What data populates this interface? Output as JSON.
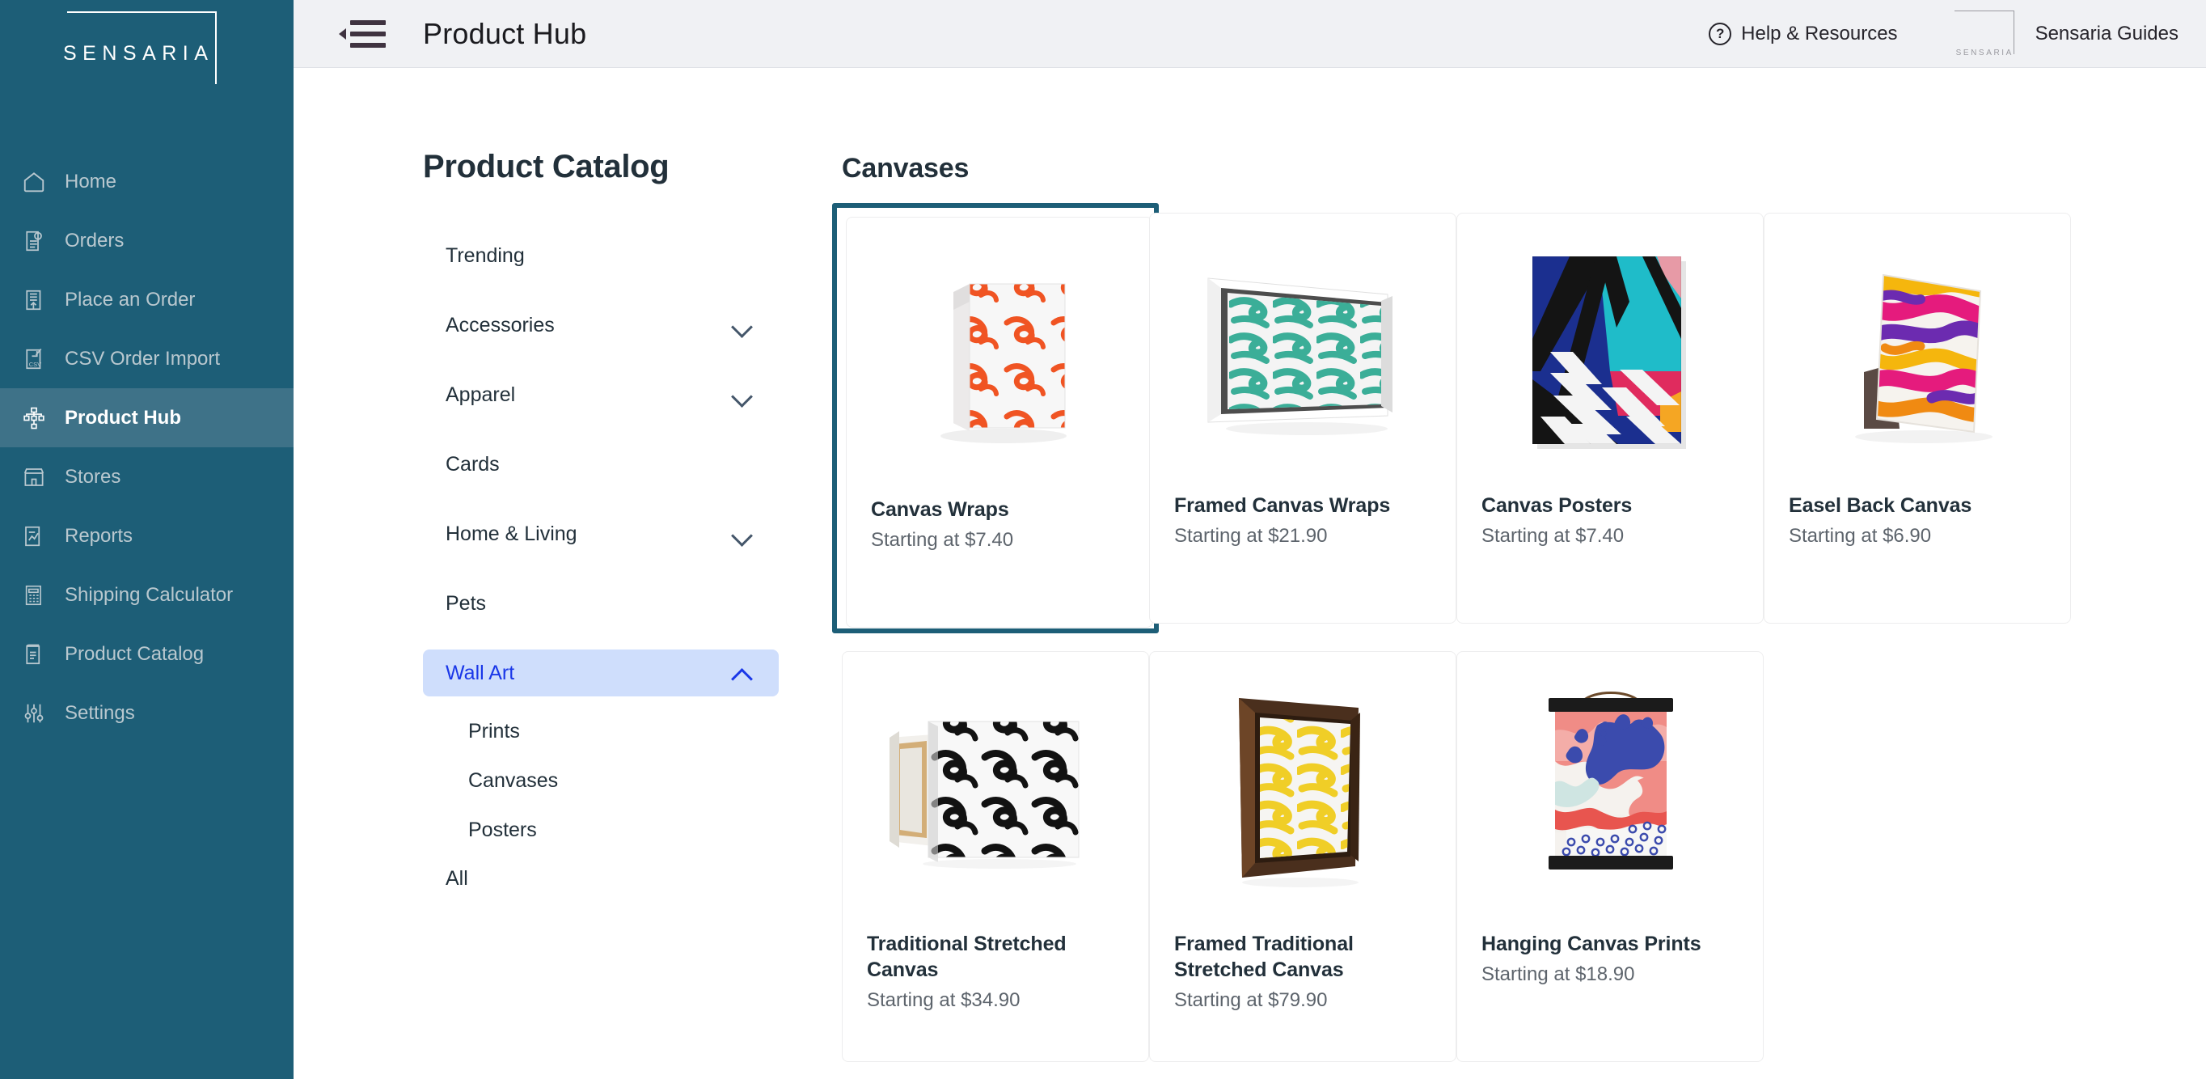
{
  "brand": {
    "name": "SENSARIA"
  },
  "sidebar": {
    "items": [
      {
        "label": "Home",
        "icon": "home-icon",
        "active": false
      },
      {
        "label": "Orders",
        "icon": "orders-document-icon",
        "active": false
      },
      {
        "label": "Place an Order",
        "icon": "place-order-icon",
        "active": false
      },
      {
        "label": "CSV Order Import",
        "icon": "csv-import-icon",
        "active": false
      },
      {
        "label": "Product Hub",
        "icon": "product-hub-icon",
        "active": true
      },
      {
        "label": "Stores",
        "icon": "storefront-icon",
        "active": false
      },
      {
        "label": "Reports",
        "icon": "reports-chart-icon",
        "active": false
      },
      {
        "label": "Shipping Calculator",
        "icon": "calculator-icon",
        "active": false
      },
      {
        "label": "Product Catalog",
        "icon": "book-icon",
        "active": false
      },
      {
        "label": "Settings",
        "icon": "sliders-icon",
        "active": false
      }
    ]
  },
  "topbar": {
    "menu_toggle": "collapse-sidebar",
    "title": "Product Hub",
    "help_label": "Help & Resources",
    "help_icon": "question-circle-icon",
    "guides_label": "Sensaria Guides",
    "guides_mark_word": "SENSARIA"
  },
  "catalog": {
    "title": "Product Catalog",
    "items": [
      {
        "label": "Trending",
        "expandable": false,
        "selected": false
      },
      {
        "label": "Accessories",
        "expandable": true,
        "selected": false
      },
      {
        "label": "Apparel",
        "expandable": true,
        "selected": false
      },
      {
        "label": "Cards",
        "expandable": false,
        "selected": false
      },
      {
        "label": "Home & Living",
        "expandable": true,
        "selected": false
      },
      {
        "label": "Pets",
        "expandable": false,
        "selected": false
      },
      {
        "label": "Wall Art",
        "expandable": true,
        "selected": true
      }
    ],
    "subitems": [
      "Prints",
      "Canvases",
      "Posters"
    ],
    "all_label": "All"
  },
  "products": {
    "section_title": "Canvases",
    "price_prefix": "Starting at ",
    "row1": [
      {
        "name": "Canvas Wraps",
        "price": "Starting at $7.40",
        "art": "orange-brush-wrap",
        "selected": true
      },
      {
        "name": "Framed Canvas Wraps",
        "price": "Starting at $21.90",
        "art": "teal-brush-framed",
        "selected": false
      },
      {
        "name": "Canvas Posters",
        "price": "Starting at $7.40",
        "art": "geometric-mural",
        "selected": false
      },
      {
        "name": "Easel Back Canvas",
        "price": "Starting at $6.90",
        "art": "magenta-yellow-easel",
        "selected": false
      }
    ],
    "row2": [
      {
        "name": "Traditional Stretched Canvas",
        "price": "Starting at $34.90",
        "art": "black-brush-stretched",
        "selected": false
      },
      {
        "name": "Framed Traditional Stretched Canvas",
        "price": "Starting at $79.90",
        "art": "yellow-brush-woodframe",
        "selected": false
      },
      {
        "name": "Hanging Canvas Prints",
        "price": "Starting at $18.90",
        "art": "pink-blue-hanging",
        "selected": false
      }
    ]
  },
  "colors": {
    "sidebar_bg": "#1d5e77",
    "sidebar_active": "#3e7288",
    "topbar_bg": "#f0f1f4",
    "selected_card_border": "#1d5e77",
    "selected_cat_bg": "#cfdefc",
    "selected_cat_text": "#1a37e8",
    "heading": "#22303a",
    "muted_text": "#5d646c"
  }
}
